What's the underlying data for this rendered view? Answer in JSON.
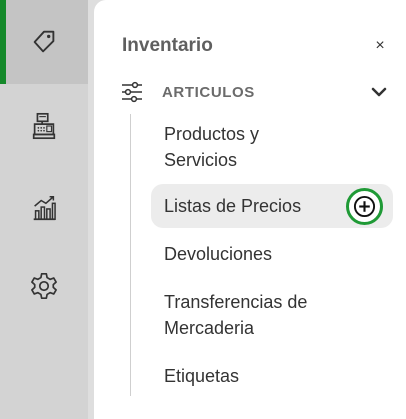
{
  "sidebar": {
    "icons": [
      {
        "name": "tag-icon",
        "active": true
      },
      {
        "name": "cash-register-icon",
        "active": false
      },
      {
        "name": "bar-chart-icon",
        "active": false
      },
      {
        "name": "gear-icon",
        "active": false
      }
    ],
    "accent_color": "#15892a"
  },
  "panel": {
    "title": "Inventario",
    "close_label": "×",
    "section": {
      "label": "ARTICULOS",
      "icon": "sliders-icon",
      "expanded": true
    },
    "items": [
      {
        "line1": "Productos y",
        "line2": "Servicios"
      },
      {
        "label": "Listas de Precios",
        "action_icon": "plus-circle-icon",
        "action_color": "#1f9a36"
      },
      {
        "label": "Devoluciones"
      },
      {
        "line1": "Transferencias de",
        "line2": "Mercaderia"
      },
      {
        "label": "Etiquetas"
      }
    ]
  }
}
